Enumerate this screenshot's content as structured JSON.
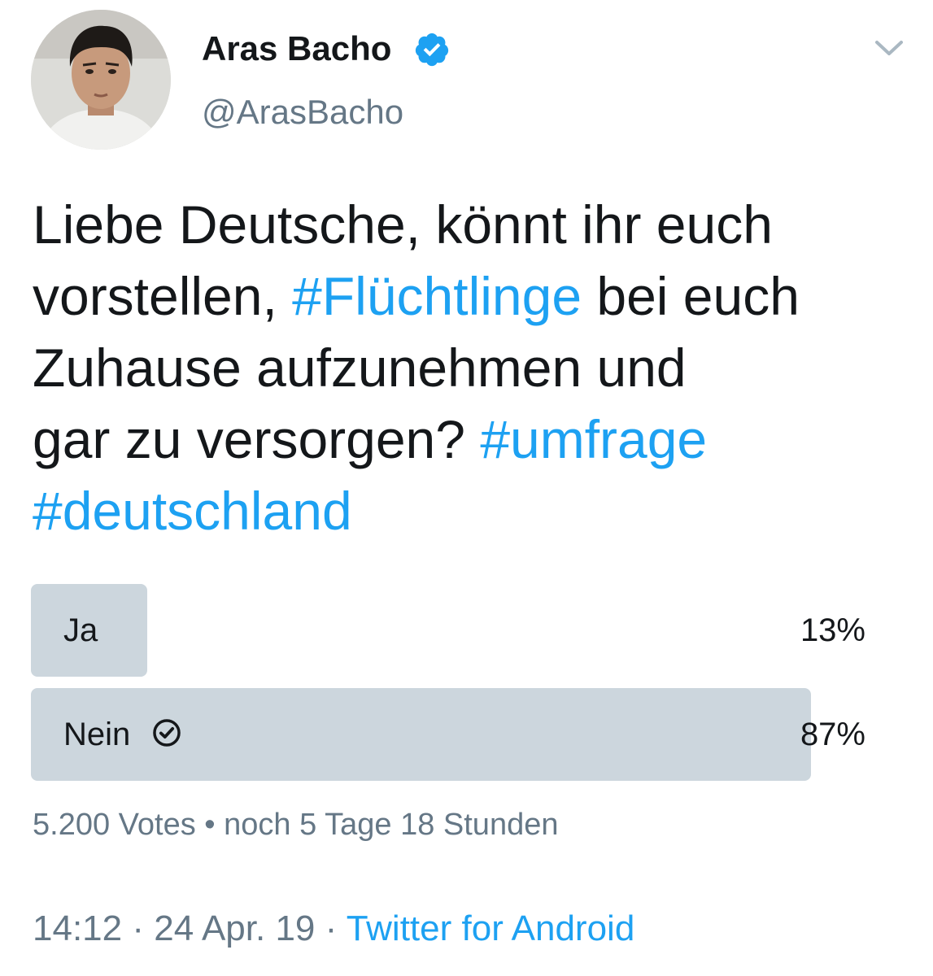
{
  "author": {
    "display_name": "Aras Bacho",
    "handle": "@ArasBacho",
    "verified_icon": "verified-badge-icon",
    "avatar": "profile-photo"
  },
  "menu_icon": "chevron-down-icon",
  "tweet": {
    "line1": "Liebe Deutsche, könnt ihr euch",
    "line2_pre": "vorstellen, ",
    "line2_tag": "#Flüchtlinge",
    "line2_post": " bei euch",
    "line3": "Zuhause aufzunehmen und",
    "line4_pre": "gar zu versorgen? ",
    "line4_tag": "#umfrage",
    "line5_tag": "#deutschland"
  },
  "poll": {
    "options": [
      {
        "label": "Ja",
        "percent_text": "13%",
        "share": 0.13,
        "winner": false
      },
      {
        "label": "Nein",
        "percent_text": "87%",
        "share": 0.87,
        "winner": true
      }
    ],
    "votes": "5.200 Votes",
    "separator": " • ",
    "remaining": "noch 5 Tage 18 Stunden"
  },
  "meta": {
    "time": "14:12",
    "sep1": " · ",
    "date": "24 Apr. 19",
    "sep2": " · ",
    "source": "Twitter for Android"
  },
  "colors": {
    "link": "#1da1f2",
    "poll_bar": "#ccd6dd",
    "muted": "#657786",
    "text": "#14171a"
  }
}
